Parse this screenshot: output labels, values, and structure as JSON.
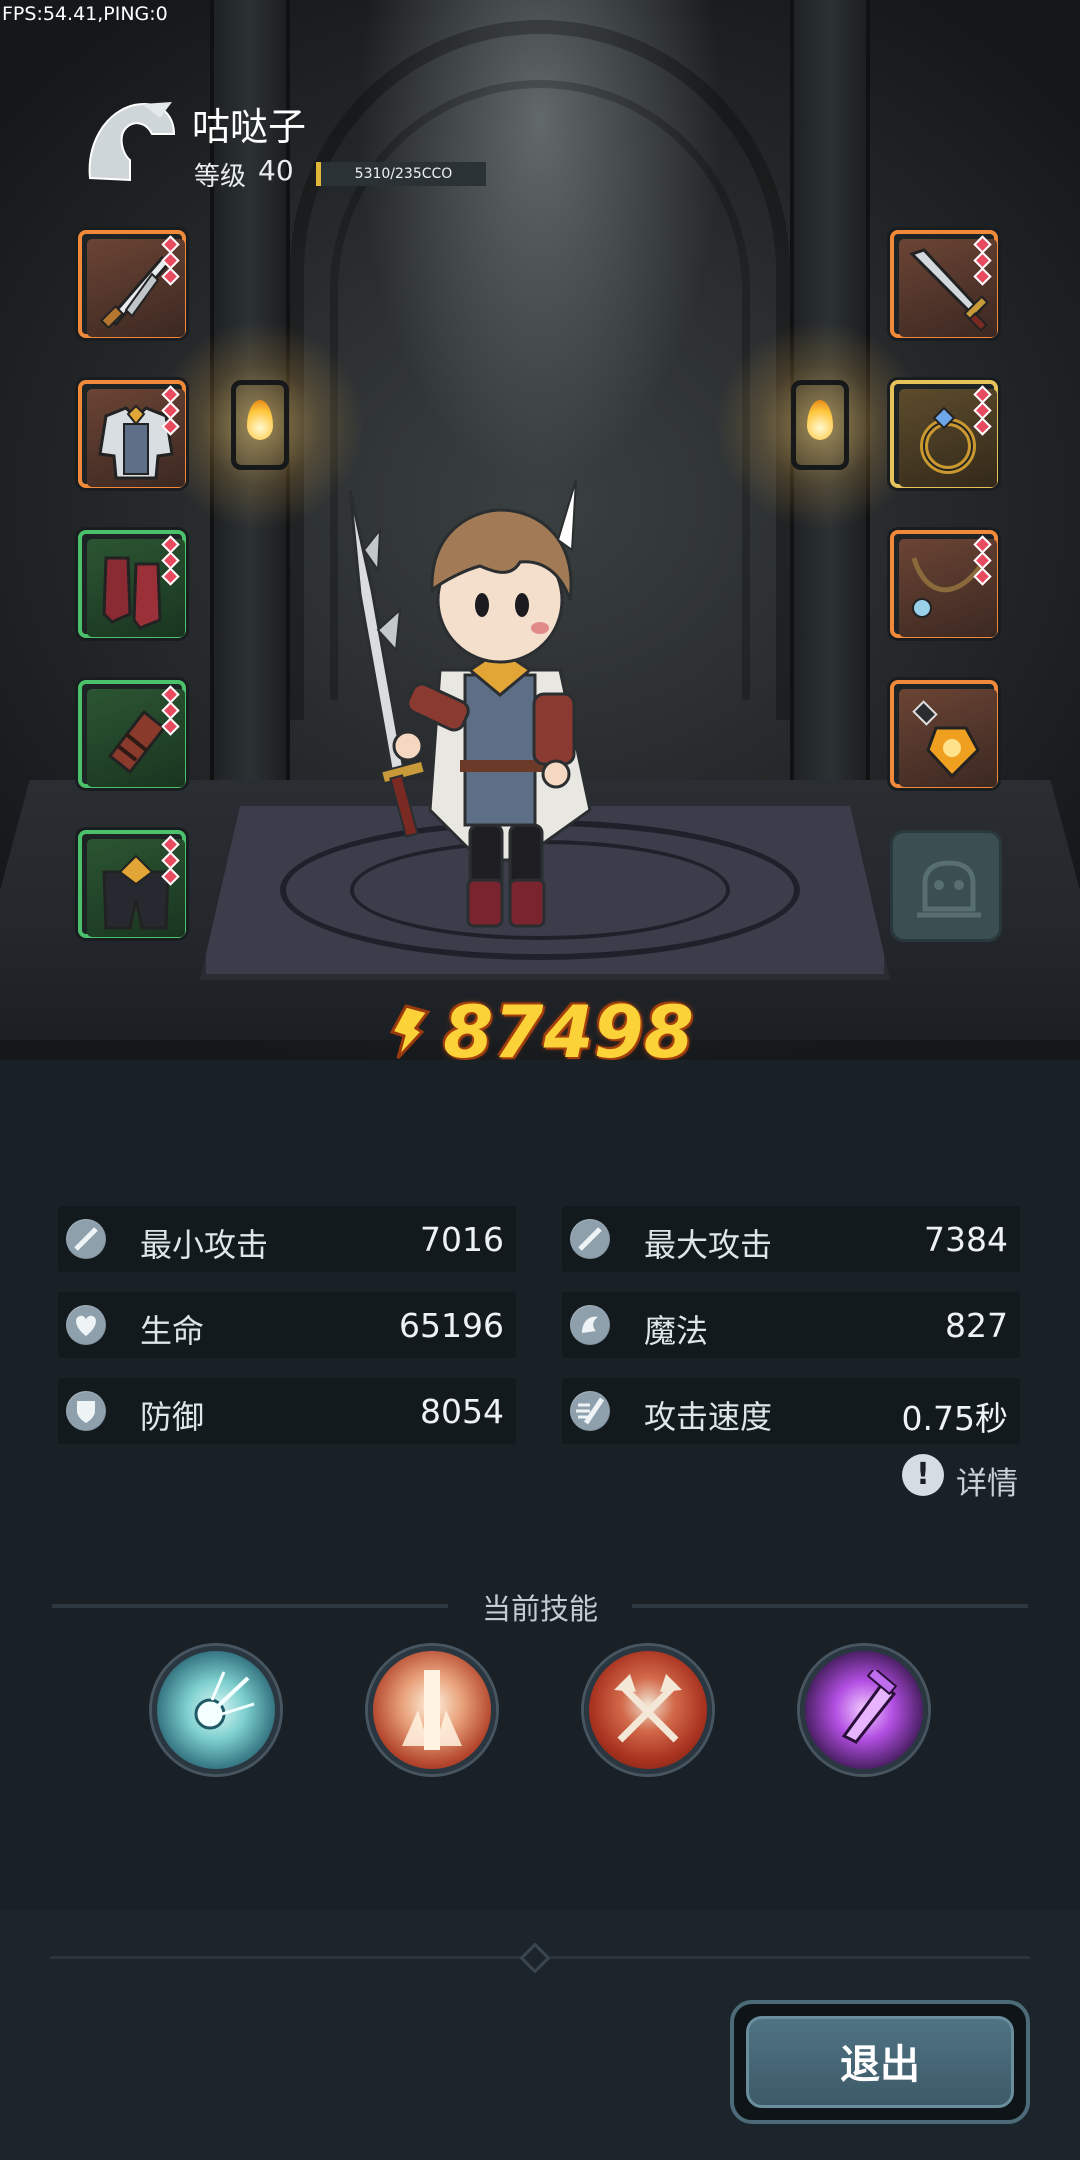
{
  "debug": {
    "fps_text": "FPS:54.41,PING:0"
  },
  "character": {
    "name": "咕哒子",
    "level_label": "等级",
    "level": "40",
    "xp_text": "5310/235CCO",
    "xp_progress": 0.023
  },
  "equipment": {
    "left": [
      {
        "slot": "dagger",
        "icon": "dagger-icon",
        "rarity": "orange",
        "gems": 3
      },
      {
        "slot": "armor",
        "icon": "armor-icon",
        "rarity": "orange",
        "gems": 3
      },
      {
        "slot": "boots",
        "icon": "boots-icon",
        "rarity": "green",
        "gems": 3
      },
      {
        "slot": "bracer",
        "icon": "bracer-icon",
        "rarity": "green",
        "gems": 3
      },
      {
        "slot": "pants",
        "icon": "pants-icon",
        "rarity": "green",
        "gems": 3
      }
    ],
    "right": [
      {
        "slot": "sword",
        "icon": "sword-icon",
        "rarity": "orange",
        "gems": 3
      },
      {
        "slot": "ring",
        "icon": "ring-icon",
        "rarity": "yellow",
        "gems": 3
      },
      {
        "slot": "necklace",
        "icon": "necklace-icon",
        "rarity": "orange",
        "gems": 3
      },
      {
        "slot": "charm",
        "icon": "charm-icon",
        "rarity": "orange",
        "gems": 0
      }
    ],
    "pet_icon": "pet-icon"
  },
  "power": {
    "icon": "power-icon",
    "value": "87498"
  },
  "stats": [
    {
      "icon": "sword-stat-icon",
      "label": "最小攻击",
      "value": "7016"
    },
    {
      "icon": "sword-stat-icon",
      "label": "最大攻击",
      "value": "7384"
    },
    {
      "icon": "heart-icon",
      "label": "生命",
      "value": "65196"
    },
    {
      "icon": "magic-icon",
      "label": "魔法",
      "value": "827"
    },
    {
      "icon": "shield-icon",
      "label": "防御",
      "value": "8054"
    },
    {
      "icon": "speed-icon",
      "label": "攻击速度",
      "value": "0.75秒"
    }
  ],
  "details": {
    "icon": "exclamation-icon",
    "label": "详情"
  },
  "skills": {
    "title": "当前技能",
    "items": [
      {
        "icon": "light-burst-skill-icon",
        "color": "#7ed0cf"
      },
      {
        "icon": "flame-pillar-skill-icon",
        "color": "#b2452c"
      },
      {
        "icon": "crossed-axes-skill-icon",
        "color": "#a8321f"
      },
      {
        "icon": "shadow-strike-skill-icon",
        "color": "#b34fe3"
      }
    ]
  },
  "footer": {
    "exit_label": "退出"
  },
  "colors": {
    "power": "#fbd238",
    "orange_rarity": "#f08a3a",
    "green_rarity": "#4bc16b",
    "yellow_rarity": "#e5c25a",
    "gem": "#e84b5f"
  }
}
